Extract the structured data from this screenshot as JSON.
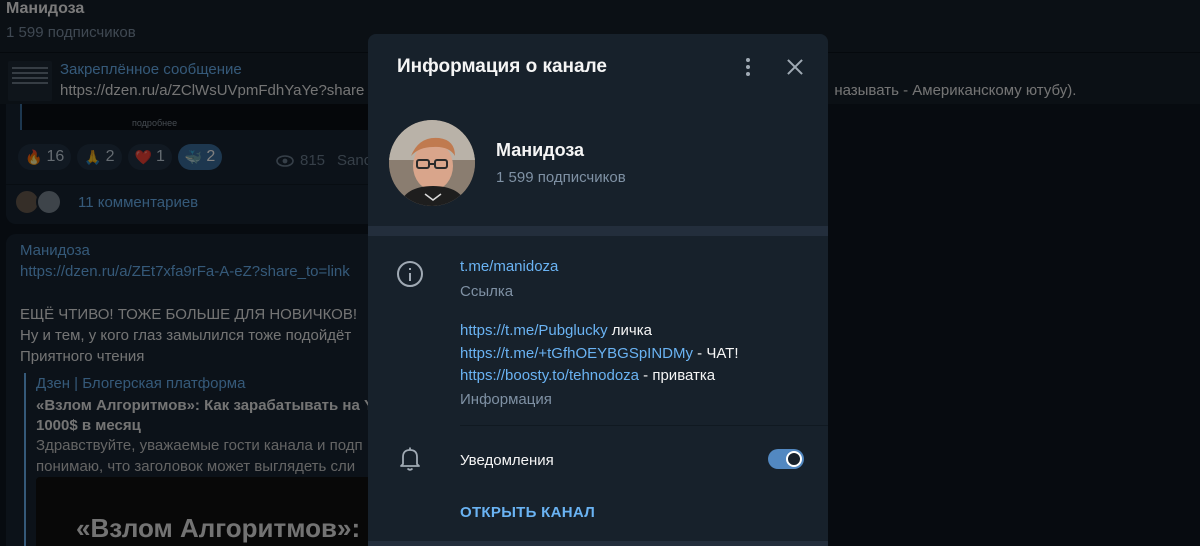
{
  "chat": {
    "title": "Манидоза",
    "subscribers": "1 599 подписчиков"
  },
  "pinned": {
    "title": "Закреплённое сообщение",
    "text": "https://dzen.ru/a/ZClWsUVpmFdhYaYe?share",
    "text_tail": "называть - Американскому ютубу).",
    "image_caption": "подробнее"
  },
  "post1": {
    "reactions": [
      {
        "icon": "fire-icon",
        "glyph": "🔥",
        "count": "16"
      },
      {
        "icon": "pray-icon",
        "glyph": "🙏",
        "count": "2"
      },
      {
        "icon": "heart-icon",
        "glyph": "❤️",
        "count": "1"
      },
      {
        "icon": "whale-icon",
        "glyph": "🐳",
        "count": "2"
      }
    ],
    "views": "815",
    "views_tail": "Sanc",
    "comments": "11 комментариев"
  },
  "post2": {
    "author": "Манидоза",
    "link": "https://dzen.ru/a/ZEt7xfa9rFa-A-eZ?share_to=link",
    "line1": "ЕЩЁ ЧТИВО! ТОЖЕ БОЛЬШЕ ДЛЯ НОВИЧКОВ!",
    "line2": "Ну и тем, у кого глаз замылился тоже подойдёт",
    "line3": "Приятного чтения",
    "preview": {
      "site": "Дзен | Блогерская платформа",
      "title1": "«Взлом Алгоритмов»: Как зарабатывать на Y",
      "title2": "1000$ в месяц",
      "desc1": "Здравствуйте, уважаемые гости канала и подп",
      "desc2": "понимаю, что заголовок может выглядеть сли",
      "image_text": "«Взлом Алгоритмов»: Ка"
    }
  },
  "dialog": {
    "title": "Информация о канале",
    "channel_name": "Манидоза",
    "channel_subscribers": "1 599 подписчиков",
    "link": "t.me/manidoza",
    "link_label": "Ссылка",
    "info_lines": [
      {
        "url": "https://t.me/Pubglucky",
        "suffix": " личка"
      },
      {
        "url": "https://t.me/+tGfhOEYBGSpINDMy",
        "suffix": " - ЧАТ!"
      },
      {
        "url": "https://boosty.to/tehnodoza",
        "suffix": " - приватка"
      }
    ],
    "info_label": "Информация",
    "notifications_label": "Уведомления",
    "notifications_on": true,
    "open_channel": "ОТКРЫТЬ КАНАЛ"
  },
  "colors": {
    "accent": "#6ab3f3",
    "panel": "#17212b",
    "toggle": "#5288c1"
  }
}
